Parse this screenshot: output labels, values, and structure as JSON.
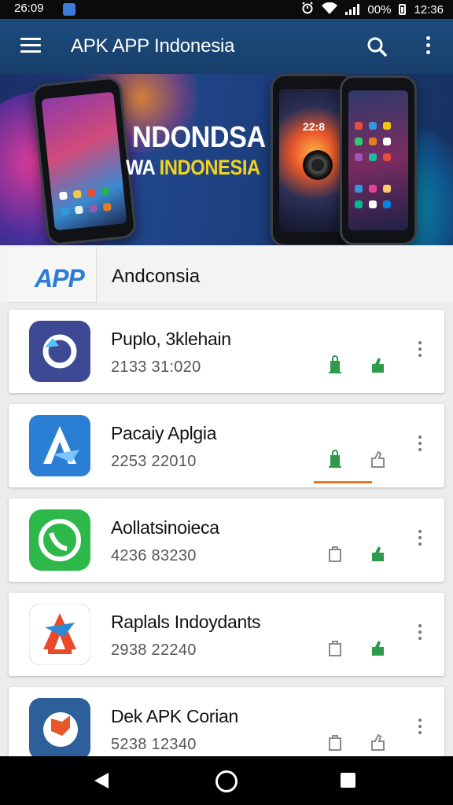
{
  "status_bar": {
    "time_left": "26:09",
    "battery_text": "00%",
    "time_right": "12:36"
  },
  "app_bar": {
    "title": "APK APP Indonesia"
  },
  "banner": {
    "headline": "NDONDSA",
    "sub_white": "WA ",
    "sub_yellow": "INDONESIA",
    "phone_label": "22:8"
  },
  "section": {
    "logo_text": "APP",
    "title": "Andconsia"
  },
  "apps": [
    {
      "name": "Puplo, 3klehain",
      "meta": "2133  31:020",
      "icon_color": "#3d4a93",
      "left_icon": "filled",
      "right_icon": "filled"
    },
    {
      "name": "Pacaiy Aplgia",
      "meta": "2253  22010",
      "icon_color": "#2a7fd4",
      "left_icon": "filled",
      "right_icon": "outline"
    },
    {
      "name": "Aollatsinoieca",
      "meta": "4236  83230",
      "icon_color": "#2fb84a",
      "left_icon": "outline",
      "right_icon": "filled"
    },
    {
      "name": "Raplals Indoydants",
      "meta": "2938  22240",
      "icon_color": "#ffffff",
      "left_icon": "outline",
      "right_icon": "filled"
    },
    {
      "name": "Dek APK Corian",
      "meta": "5238  12340",
      "icon_color": "#2d5f9a",
      "left_icon": "outline",
      "right_icon": "outline"
    }
  ],
  "colors": {
    "app_bar": "#1c4c7e",
    "accent_green": "#2e9a4a",
    "underline": "#e07a2a"
  }
}
